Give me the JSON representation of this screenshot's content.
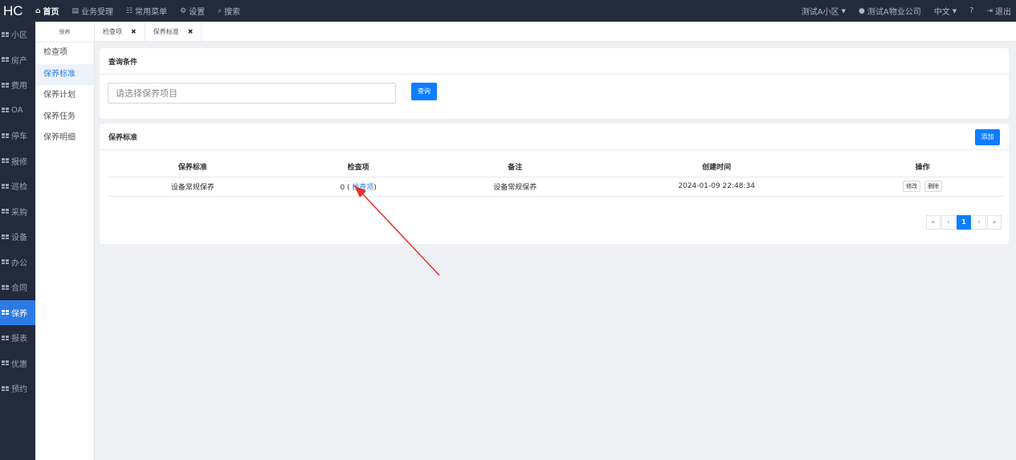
{
  "topbar": {
    "logo": "HC",
    "nav": [
      {
        "icon": "home-icon",
        "glyph": "⌂",
        "label": "首页"
      },
      {
        "icon": "briefcase-icon",
        "glyph": "▤",
        "label": "业务受理"
      },
      {
        "icon": "sitemap-icon",
        "glyph": "☷",
        "label": "常用菜单"
      },
      {
        "icon": "gear-icon",
        "glyph": "⚙",
        "label": "设置"
      },
      {
        "icon": "search-icon",
        "glyph": "⌕",
        "label": "搜索"
      }
    ],
    "community": "测试A小区",
    "company": "测试A物业公司",
    "language": "中文",
    "help_glyph": "?",
    "logout": "退出"
  },
  "sidebar": {
    "items": [
      "小区",
      "房产",
      "费用",
      "OA",
      "停车",
      "报修",
      "巡检",
      "采购",
      "设备",
      "办公",
      "合同",
      "保养",
      "报表",
      "优惠",
      "预约"
    ],
    "active_index": 11
  },
  "subsidebar": {
    "title": "保养",
    "links": [
      "检查项",
      "保养标准",
      "保养计划",
      "保养任务",
      "保养明细"
    ],
    "active_index": 1
  },
  "tabs": [
    {
      "label": "检查项",
      "close": "✖"
    },
    {
      "label": "保养标准",
      "close": "✖"
    }
  ],
  "query_panel": {
    "title": "查询条件",
    "input_placeholder": "请选择保养项目",
    "query_button": "查询"
  },
  "list_panel": {
    "title": "保养标准",
    "add_button": "添加",
    "columns": [
      "保养标准",
      "检查项",
      "备注",
      "创建时间",
      "操作"
    ],
    "rows": [
      {
        "standard": "设备常规保养",
        "items_count": "0",
        "items_link": "检查项",
        "remark": "设备常规保养",
        "created": "2024-01-09 22:48:34",
        "edit": "修改",
        "delete": "删除"
      }
    ]
  },
  "pagination": {
    "first": "«",
    "prev": "‹",
    "current": "1",
    "next": "›",
    "last": "»"
  },
  "colors": {
    "topbar_bg": "#232a3b",
    "accent": "#0d7eff",
    "arrow": "#e8302a"
  }
}
